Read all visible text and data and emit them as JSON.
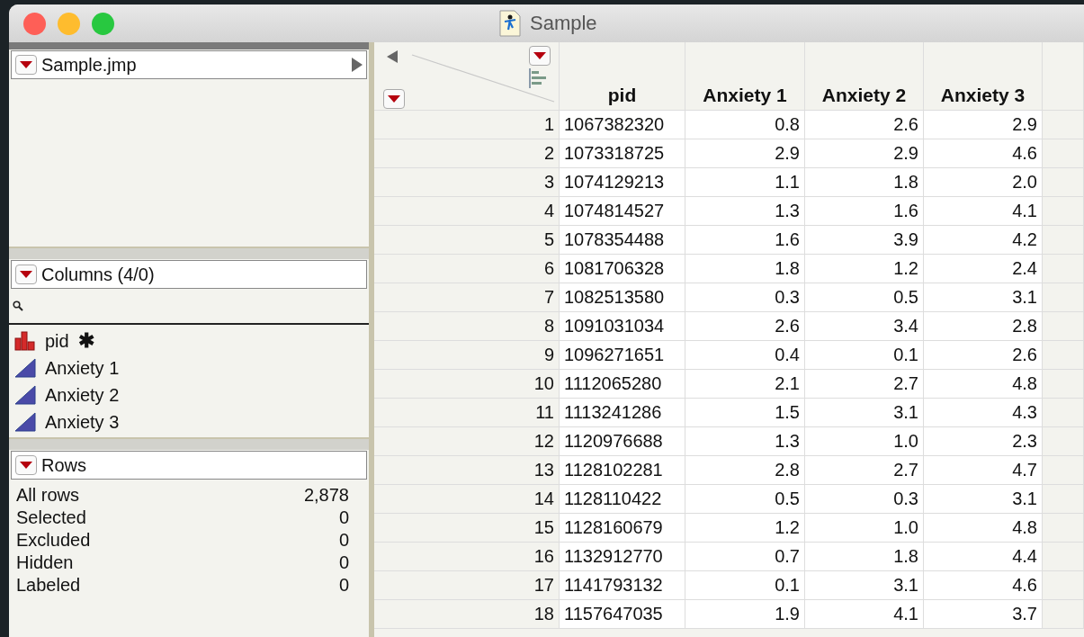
{
  "window": {
    "title": "Sample"
  },
  "table_panel": {
    "name": "Sample.jmp"
  },
  "columns_panel": {
    "title": "Columns (4/0)",
    "items": [
      {
        "name": "pid",
        "kind": "nominal",
        "marker": "✱"
      },
      {
        "name": "Anxiety 1",
        "kind": "continuous"
      },
      {
        "name": "Anxiety 2",
        "kind": "continuous"
      },
      {
        "name": "Anxiety 3",
        "kind": "continuous"
      }
    ]
  },
  "rows_panel": {
    "title": "Rows",
    "stats": [
      {
        "label": "All rows",
        "value": "2,878"
      },
      {
        "label": "Selected",
        "value": "0"
      },
      {
        "label": "Excluded",
        "value": "0"
      },
      {
        "label": "Hidden",
        "value": "0"
      },
      {
        "label": "Labeled",
        "value": "0"
      }
    ]
  },
  "table": {
    "columns": [
      "pid",
      "Anxiety 1",
      "Anxiety 2",
      "Anxiety 3"
    ],
    "rows": [
      {
        "number": "1",
        "cells": [
          "1067382320",
          "0.8",
          "2.6",
          "2.9"
        ]
      },
      {
        "number": "2",
        "cells": [
          "1073318725",
          "2.9",
          "2.9",
          "4.6"
        ]
      },
      {
        "number": "3",
        "cells": [
          "1074129213",
          "1.1",
          "1.8",
          "2.0"
        ]
      },
      {
        "number": "4",
        "cells": [
          "1074814527",
          "1.3",
          "1.6",
          "4.1"
        ]
      },
      {
        "number": "5",
        "cells": [
          "1078354488",
          "1.6",
          "3.9",
          "4.2"
        ]
      },
      {
        "number": "6",
        "cells": [
          "1081706328",
          "1.8",
          "1.2",
          "2.4"
        ]
      },
      {
        "number": "7",
        "cells": [
          "1082513580",
          "0.3",
          "0.5",
          "3.1"
        ]
      },
      {
        "number": "8",
        "cells": [
          "1091031034",
          "2.6",
          "3.4",
          "2.8"
        ]
      },
      {
        "number": "9",
        "cells": [
          "1096271651",
          "0.4",
          "0.1",
          "2.6"
        ]
      },
      {
        "number": "10",
        "cells": [
          "1112065280",
          "2.1",
          "2.7",
          "4.8"
        ]
      },
      {
        "number": "11",
        "cells": [
          "1113241286",
          "1.5",
          "3.1",
          "4.3"
        ]
      },
      {
        "number": "12",
        "cells": [
          "1120976688",
          "1.3",
          "1.0",
          "2.3"
        ]
      },
      {
        "number": "13",
        "cells": [
          "1128102281",
          "2.8",
          "2.7",
          "4.7"
        ]
      },
      {
        "number": "14",
        "cells": [
          "1128110422",
          "0.5",
          "0.3",
          "3.1"
        ]
      },
      {
        "number": "15",
        "cells": [
          "1128160679",
          "1.2",
          "1.0",
          "4.8"
        ]
      },
      {
        "number": "16",
        "cells": [
          "1132912770",
          "0.7",
          "1.8",
          "4.4"
        ]
      },
      {
        "number": "17",
        "cells": [
          "1141793132",
          "0.1",
          "3.1",
          "4.6"
        ]
      },
      {
        "number": "18",
        "cells": [
          "1157647035",
          "1.9",
          "4.1",
          "3.7"
        ]
      }
    ]
  }
}
